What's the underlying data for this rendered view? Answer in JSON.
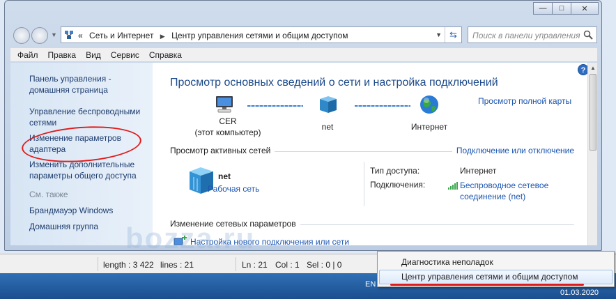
{
  "window": {
    "caption_buttons": {
      "minimize": "—",
      "maximize": "□",
      "close": "✕"
    }
  },
  "address": {
    "prefix": "«",
    "crumbs": [
      "Сеть и Интернет",
      "Центр управления сетями и общим доступом"
    ],
    "search_placeholder": "Поиск в панели управления"
  },
  "menu": [
    "Файл",
    "Правка",
    "Вид",
    "Сервис",
    "Справка"
  ],
  "sidebar": {
    "home": "Панель управления - домашняя страница",
    "wireless": "Управление беспроводными сетями",
    "adapter": "Изменение параметров адаптера",
    "sharing": "Изменить дополнительные параметры общего доступа",
    "see_also": "См. также",
    "firewall": "Брандмауэр Windows",
    "homegroup": "Домашняя группа"
  },
  "main": {
    "help": "?",
    "title": "Просмотр основных сведений о сети и настройка подключений",
    "full_map": "Просмотр полной карты",
    "map": {
      "computer": "CER",
      "computer_sub": "(этот компьютер)",
      "network": "net",
      "internet": "Интернет"
    },
    "active_title": "Просмотр активных сетей",
    "connect_link": "Подключение или отключение",
    "active": {
      "name": "net",
      "type": "Рабочая сеть",
      "access_label": "Тип доступа:",
      "access_value": "Интернет",
      "conn_label": "Подключения:",
      "conn_value": "Беспроводное сетевое соединение (net)"
    },
    "change_title": "Изменение сетевых параметров",
    "setup_link": "Настройка нового подключения или сети"
  },
  "watermark": "bozza.ru",
  "status": {
    "length": "length : 3 422",
    "lines": "lines : 21",
    "ln": "Ln : 21",
    "col": "Col : 1",
    "sel": "Sel : 0 | 0"
  },
  "taskbar": {
    "lang": "EN",
    "date": "01.03.2020"
  },
  "popup": {
    "troubleshoot": "Диагностика неполадок",
    "center": "Центр управления сетями и общим доступом"
  },
  "colors": {
    "link": "#1c56b0",
    "title": "#1c4a8a",
    "highlight": "#e01b1b",
    "taskbar": "#1b4f8f"
  }
}
